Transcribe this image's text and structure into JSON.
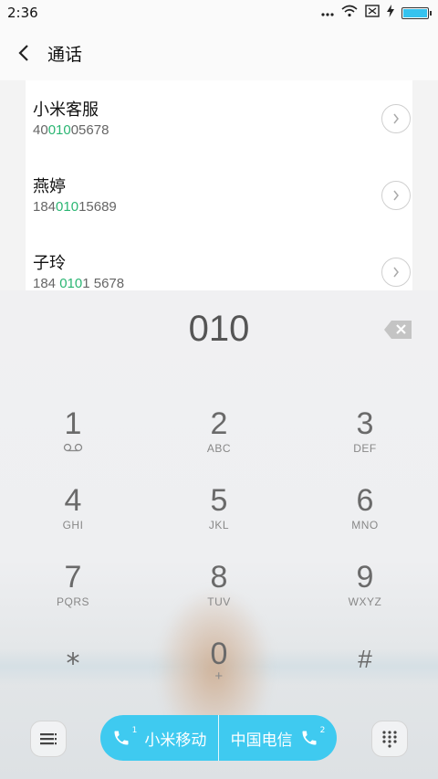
{
  "status_bar": {
    "time": "2:36"
  },
  "header": {
    "title": "通话"
  },
  "results": [
    {
      "name": "小米客服",
      "num_pre": "40",
      "num_hl": "010",
      "num_post": "05678"
    },
    {
      "name": "燕婷",
      "num_pre": "184",
      "num_hl": "010",
      "num_post": "15689"
    },
    {
      "name": "子玲",
      "num_pre": "184 ",
      "num_hl": "010",
      "num_post": "1 5678"
    }
  ],
  "dial": {
    "typed": "010"
  },
  "keys": [
    {
      "digit": "1",
      "letters": ""
    },
    {
      "digit": "2",
      "letters": "ABC"
    },
    {
      "digit": "3",
      "letters": "DEF"
    },
    {
      "digit": "4",
      "letters": "GHI"
    },
    {
      "digit": "5",
      "letters": "JKL"
    },
    {
      "digit": "6",
      "letters": "MNO"
    },
    {
      "digit": "7",
      "letters": "PQRS"
    },
    {
      "digit": "8",
      "letters": "TUV"
    },
    {
      "digit": "9",
      "letters": "WXYZ"
    },
    {
      "digit": "⁎",
      "letters": ""
    },
    {
      "digit": "0",
      "letters": "+"
    },
    {
      "digit": "#",
      "letters": ""
    }
  ],
  "call_buttons": {
    "sim1_label": "小米移动",
    "sim1_index": "1",
    "sim2_label": "中国电信",
    "sim2_index": "2"
  },
  "colors": {
    "accent": "#3fcaf0",
    "match_highlight": "#2bb673",
    "battery": "#35c3ef"
  },
  "icons": [
    "back-arrow-icon",
    "chevron-right-icon",
    "backspace-icon",
    "voicemail-icon",
    "menu-icon",
    "phone-icon",
    "keypad-icon",
    "wifi-icon",
    "signal-icon",
    "battery-icon"
  ]
}
